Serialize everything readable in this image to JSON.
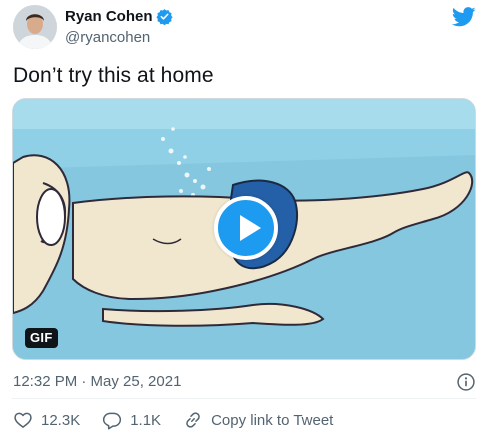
{
  "author": {
    "display_name": "Ryan Cohen",
    "handle": "@ryancohen",
    "verified": true
  },
  "tweet": {
    "text": "Don’t try this at home",
    "media_badge": "GIF",
    "timestamp": "12:32 PM · May 25, 2021"
  },
  "actions": {
    "likes": "12.3K",
    "replies": "1.1K",
    "share_label": "Copy link to Tweet"
  },
  "colors": {
    "brand": "#1d9bf0",
    "secondary_text": "#536471"
  },
  "icons": {
    "logo": "twitter-bird-icon",
    "verified": "verified-badge-icon",
    "info": "info-icon",
    "like": "heart-icon",
    "reply": "reply-icon",
    "share": "link-icon",
    "play": "play-icon"
  }
}
